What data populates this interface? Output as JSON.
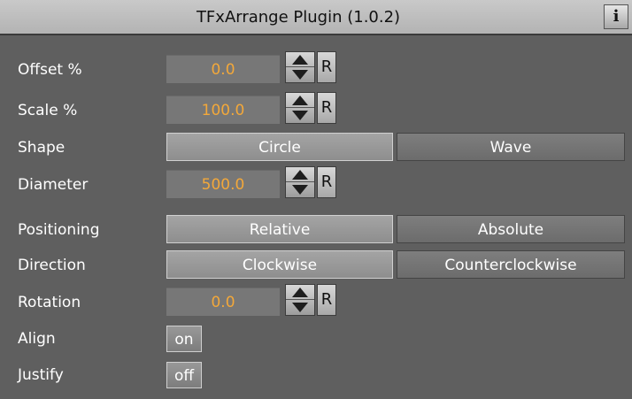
{
  "window": {
    "title": "TFxArrange Plugin (1.0.2)",
    "info_label": "i"
  },
  "rows": {
    "offset": {
      "label": "Offset %",
      "value": "0.0",
      "reset": "R"
    },
    "scale": {
      "label": "Scale %",
      "value": "100.0",
      "reset": "R"
    },
    "shape": {
      "label": "Shape",
      "options": [
        "Circle",
        "Wave"
      ],
      "selected": "Circle"
    },
    "diameter": {
      "label": "Diameter",
      "value": "500.0",
      "reset": "R"
    },
    "positioning": {
      "label": "Positioning",
      "options": [
        "Relative",
        "Absolute"
      ],
      "selected": "Relative"
    },
    "direction": {
      "label": "Direction",
      "options": [
        "Clockwise",
        "Counterclockwise"
      ],
      "selected": "Clockwise"
    },
    "rotation": {
      "label": "Rotation",
      "value": "0.0",
      "reset": "R"
    },
    "align": {
      "label": "Align",
      "value": "on"
    },
    "justify": {
      "label": "Justify",
      "value": "off"
    }
  },
  "colors": {
    "value_text": "#f3a83a",
    "panel_bg": "#5f5f5f"
  },
  "icons": {
    "spinner": "up-down-arrows-icon",
    "info": "info-icon"
  }
}
